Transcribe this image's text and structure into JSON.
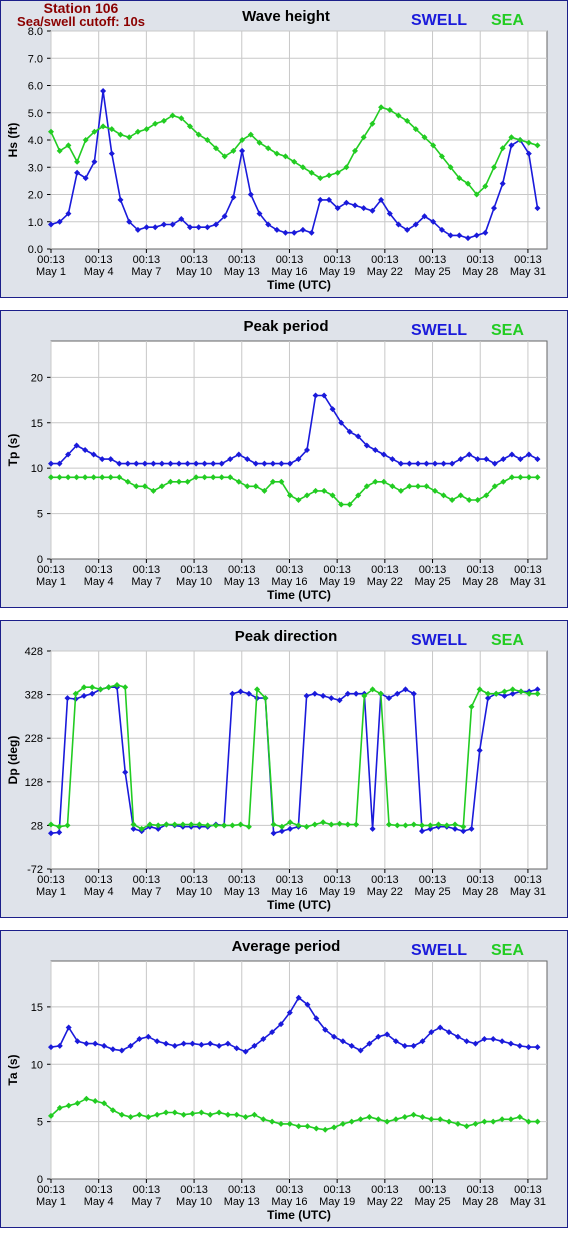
{
  "station": {
    "name": "Station 106",
    "cutoff": "Sea/swell cutoff: 10s"
  },
  "legend": {
    "swell": "SWELL",
    "sea": "SEA"
  },
  "colors": {
    "swell": "#1a1adb",
    "sea": "#22cc22",
    "grid": "#c8c8c8",
    "panel_bg": "#dfe3ea",
    "border": "#1c1f8a",
    "station_text": "#8b0000"
  },
  "xaxis": {
    "label": "Time (UTC)",
    "ticks": [
      {
        "day": 1,
        "time": "00:13",
        "date": "May 1"
      },
      {
        "day": 4,
        "time": "00:13",
        "date": "May 4"
      },
      {
        "day": 7,
        "time": "00:13",
        "date": "May 7"
      },
      {
        "day": 10,
        "time": "00:13",
        "date": "May 10"
      },
      {
        "day": 13,
        "time": "00:13",
        "date": "May 13"
      },
      {
        "day": 16,
        "time": "00:13",
        "date": "May 16"
      },
      {
        "day": 19,
        "time": "00:13",
        "date": "May 19"
      },
      {
        "day": 22,
        "time": "00:13",
        "date": "May 22"
      },
      {
        "day": 25,
        "time": "00:13",
        "date": "May 25"
      },
      {
        "day": 28,
        "time": "00:13",
        "date": "May 28"
      },
      {
        "day": 31,
        "time": "00:13",
        "date": "May 31"
      }
    ],
    "range": [
      1,
      32.2
    ]
  },
  "chart_data": [
    {
      "type": "line",
      "title": "Wave height",
      "ylabel": "Hs (ft)",
      "ylim": [
        0,
        8
      ],
      "yticks": [
        "0.0",
        "1.0",
        "2.0",
        "3.0",
        "4.0",
        "5.0",
        "6.0",
        "7.0",
        "8.0"
      ],
      "ytick_values": [
        0,
        1,
        2,
        3,
        4,
        5,
        6,
        7,
        8
      ],
      "x": [
        1,
        1.5,
        2,
        2.5,
        3,
        3.5,
        4,
        4.5,
        5,
        5.5,
        6,
        6.5,
        7,
        7.5,
        8,
        8.5,
        9,
        9.5,
        10,
        10.5,
        11,
        11.5,
        12,
        12.5,
        13,
        13.5,
        14,
        14.5,
        15,
        15.5,
        16,
        16.5,
        17,
        17.5,
        18,
        18.5,
        19,
        19.5,
        20,
        20.5,
        21,
        21.5,
        22,
        22.5,
        23,
        23.5,
        24,
        24.5,
        25,
        25.5,
        26,
        26.5,
        27,
        27.5,
        28,
        28.5,
        29,
        29.5,
        30,
        30.5,
        31,
        31.5,
        32
      ],
      "series": [
        {
          "name": "SWELL",
          "values": [
            0.9,
            1.0,
            1.3,
            2.8,
            2.6,
            3.2,
            5.8,
            3.5,
            1.8,
            1.0,
            0.7,
            0.8,
            0.8,
            0.9,
            0.9,
            1.1,
            0.8,
            0.8,
            0.8,
            0.9,
            1.2,
            1.9,
            3.6,
            2.0,
            1.3,
            0.9,
            0.7,
            0.6,
            0.6,
            0.7,
            0.6,
            1.8,
            1.8,
            1.5,
            1.7,
            1.6,
            1.5,
            1.4,
            1.8,
            1.3,
            0.9,
            0.7,
            0.9,
            1.2,
            1.0,
            0.7,
            0.5,
            0.5,
            0.4,
            0.5,
            0.6,
            1.5,
            2.4,
            3.8,
            4.0,
            3.5,
            1.5
          ]
        },
        {
          "name": "SEA",
          "values": [
            4.3,
            3.6,
            3.8,
            3.2,
            4.0,
            4.3,
            4.5,
            4.4,
            4.2,
            4.1,
            4.3,
            4.4,
            4.6,
            4.7,
            4.9,
            4.8,
            4.5,
            4.2,
            4.0,
            3.7,
            3.4,
            3.6,
            4.0,
            4.2,
            3.9,
            3.7,
            3.5,
            3.4,
            3.2,
            3.0,
            2.8,
            2.6,
            2.7,
            2.8,
            3.0,
            3.6,
            4.1,
            4.6,
            5.2,
            5.1,
            4.9,
            4.7,
            4.4,
            4.1,
            3.8,
            3.4,
            3.0,
            2.6,
            2.4,
            2.0,
            2.3,
            3.0,
            3.7,
            4.1,
            4.0,
            3.9,
            3.8
          ]
        }
      ]
    },
    {
      "type": "line",
      "title": "Peak period",
      "ylabel": "Tp (s)",
      "ylim": [
        0,
        24
      ],
      "yticks": [
        "0",
        "5",
        "10",
        "15",
        "20"
      ],
      "ytick_values": [
        0,
        5,
        10,
        15,
        20
      ],
      "x": [
        1,
        1.5,
        2,
        2.5,
        3,
        3.5,
        4,
        4.5,
        5,
        5.5,
        6,
        6.5,
        7,
        7.5,
        8,
        8.5,
        9,
        9.5,
        10,
        10.5,
        11,
        11.5,
        12,
        12.5,
        13,
        13.5,
        14,
        14.5,
        15,
        15.5,
        16,
        16.5,
        17,
        17.5,
        18,
        18.5,
        19,
        19.5,
        20,
        20.5,
        21,
        21.5,
        22,
        22.5,
        23,
        23.5,
        24,
        24.5,
        25,
        25.5,
        26,
        26.5,
        27,
        27.5,
        28,
        28.5,
        29,
        29.5,
        30,
        30.5,
        31,
        31.5,
        32
      ],
      "series": [
        {
          "name": "SWELL",
          "values": [
            10.5,
            10.5,
            11.5,
            12.5,
            12,
            11.5,
            11,
            11,
            10.5,
            10.5,
            10.5,
            10.5,
            10.5,
            10.5,
            10.5,
            10.5,
            10.5,
            10.5,
            10.5,
            10.5,
            10.5,
            11,
            11.5,
            11,
            10.5,
            10.5,
            10.5,
            10.5,
            10.5,
            11,
            12,
            18,
            18,
            16.5,
            15,
            14,
            13.5,
            12.5,
            12,
            11.5,
            11,
            10.5,
            10.5,
            10.5,
            10.5,
            10.5,
            10.5,
            10.5,
            11,
            11.5,
            11,
            11,
            10.5,
            11,
            11.5,
            11,
            11.5,
            11
          ]
        },
        {
          "name": "SEA",
          "values": [
            9,
            9,
            9,
            9,
            9,
            9,
            9,
            9,
            9,
            8.5,
            8,
            8,
            7.5,
            8,
            8.5,
            8.5,
            8.5,
            9,
            9,
            9,
            9,
            9,
            8.5,
            8,
            8,
            7.5,
            8.5,
            8.5,
            7,
            6.5,
            7,
            7.5,
            7.5,
            7,
            6,
            6,
            7,
            8,
            8.5,
            8.5,
            8,
            7.5,
            8,
            8,
            8,
            7.5,
            7,
            6.5,
            7,
            6.5,
            6.5,
            7,
            8,
            8.5,
            9,
            9,
            9,
            9
          ]
        }
      ]
    },
    {
      "type": "line",
      "title": "Peak direction",
      "ylabel": "Dp (deg)",
      "ylim": [
        -72,
        428
      ],
      "yticks": [
        "-72",
        "28",
        "128",
        "228",
        "328",
        "428"
      ],
      "ytick_values": [
        -72,
        28,
        128,
        228,
        328,
        428
      ],
      "x": [
        1,
        1.5,
        2,
        2.5,
        3,
        3.5,
        4,
        4.5,
        5,
        5.5,
        6,
        6.5,
        7,
        7.5,
        8,
        8.5,
        9,
        9.5,
        10,
        10.5,
        11,
        11.5,
        12,
        12.5,
        13,
        13.5,
        14,
        14.5,
        15,
        15.5,
        16,
        16.5,
        17,
        17.5,
        18,
        18.5,
        19,
        19.5,
        20,
        20.5,
        21,
        21.5,
        22,
        22.5,
        23,
        23.5,
        24,
        24.5,
        25,
        25.5,
        26,
        26.5,
        27,
        27.5,
        28,
        28.5,
        29,
        29.5,
        30,
        30.5,
        31,
        31.5,
        32
      ],
      "series": [
        {
          "name": "SWELL",
          "values": [
            10,
            12,
            320,
            318,
            325,
            330,
            340,
            345,
            345,
            150,
            20,
            15,
            25,
            20,
            30,
            28,
            25,
            25,
            25,
            25,
            30,
            28,
            330,
            335,
            330,
            320,
            320,
            10,
            15,
            20,
            25,
            325,
            330,
            325,
            320,
            315,
            330,
            330,
            330,
            20,
            330,
            320,
            330,
            340,
            330,
            15,
            20,
            25,
            25,
            20,
            15,
            20,
            200,
            320,
            330,
            325,
            330,
            335,
            335,
            340
          ]
        },
        {
          "name": "SEA",
          "values": [
            30,
            25,
            28,
            330,
            345,
            345,
            340,
            345,
            350,
            345,
            30,
            20,
            30,
            28,
            30,
            30,
            30,
            30,
            30,
            28,
            28,
            28,
            28,
            30,
            25,
            340,
            320,
            30,
            25,
            35,
            28,
            25,
            30,
            35,
            30,
            32,
            30,
            30,
            325,
            340,
            330,
            30,
            28,
            28,
            30,
            28,
            28,
            30,
            28,
            30,
            25,
            300,
            340,
            330,
            330,
            335,
            340,
            335,
            330,
            330
          ]
        }
      ]
    },
    {
      "type": "line",
      "title": "Average period",
      "ylabel": "Ta (s)",
      "ylim": [
        0,
        19
      ],
      "yticks": [
        "0",
        "5",
        "10",
        "15"
      ],
      "ytick_values": [
        0,
        5,
        10,
        15
      ],
      "x": [
        1,
        1.5,
        2,
        2.5,
        3,
        3.5,
        4,
        4.5,
        5,
        5.5,
        6,
        6.5,
        7,
        7.5,
        8,
        8.5,
        9,
        9.5,
        10,
        10.5,
        11,
        11.5,
        12,
        12.5,
        13,
        13.5,
        14,
        14.5,
        15,
        15.5,
        16,
        16.5,
        17,
        17.5,
        18,
        18.5,
        19,
        19.5,
        20,
        20.5,
        21,
        21.5,
        22,
        22.5,
        23,
        23.5,
        24,
        24.5,
        25,
        25.5,
        26,
        26.5,
        27,
        27.5,
        28,
        28.5,
        29,
        29.5,
        30,
        30.5,
        31,
        31.5,
        32
      ],
      "series": [
        {
          "name": "SWELL",
          "values": [
            11.5,
            11.6,
            13.2,
            12.0,
            11.8,
            11.8,
            11.6,
            11.3,
            11.2,
            11.6,
            12.2,
            12.4,
            12.0,
            11.8,
            11.6,
            11.8,
            11.8,
            11.7,
            11.8,
            11.6,
            11.8,
            11.4,
            11.1,
            11.6,
            12.2,
            12.8,
            13.5,
            14.5,
            15.8,
            15.2,
            14.0,
            13.0,
            12.4,
            12.0,
            11.6,
            11.2,
            11.8,
            12.4,
            12.6,
            12.0,
            11.6,
            11.6,
            12.0,
            12.8,
            13.2,
            12.8,
            12.4,
            12.0,
            11.8,
            12.2,
            12.2,
            12.0,
            11.8,
            11.6,
            11.5,
            11.5
          ]
        },
        {
          "name": "SEA",
          "values": [
            5.5,
            6.2,
            6.4,
            6.6,
            7.0,
            6.8,
            6.6,
            6.0,
            5.6,
            5.4,
            5.6,
            5.4,
            5.6,
            5.8,
            5.8,
            5.6,
            5.7,
            5.8,
            5.6,
            5.8,
            5.6,
            5.6,
            5.4,
            5.6,
            5.2,
            5.0,
            4.8,
            4.8,
            4.6,
            4.6,
            4.4,
            4.3,
            4.5,
            4.8,
            5.0,
            5.2,
            5.4,
            5.2,
            5.0,
            5.2,
            5.4,
            5.6,
            5.4,
            5.2,
            5.2,
            5.0,
            4.8,
            4.6,
            4.8,
            5.0,
            5.0,
            5.2,
            5.2,
            5.4,
            5.0,
            5.0
          ]
        }
      ]
    }
  ]
}
